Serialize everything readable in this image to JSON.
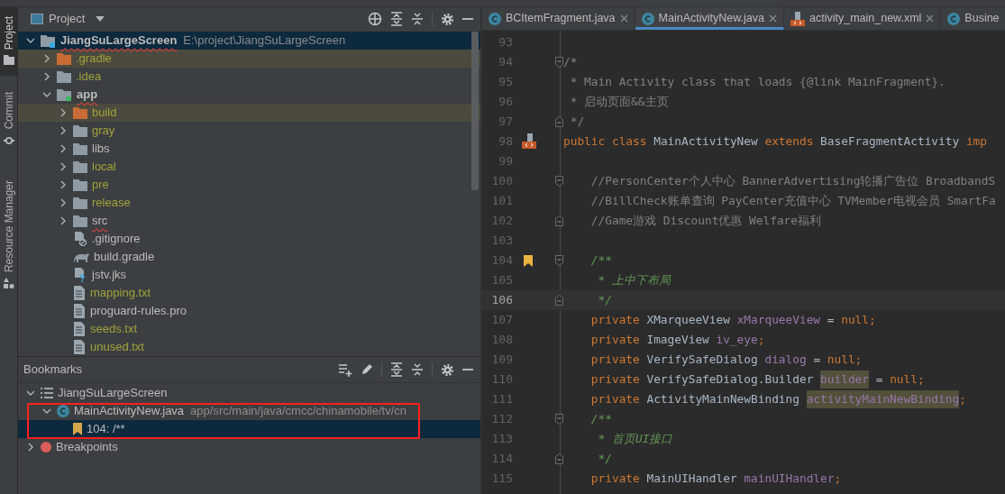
{
  "tool_stripe": [
    {
      "label": "Project",
      "kind": "folder",
      "selected": true
    },
    {
      "label": "Commit",
      "kind": "commit",
      "selected": false
    },
    {
      "label": "Resource Manager",
      "kind": "shapes",
      "selected": false
    }
  ],
  "project_panel": {
    "title": "Project",
    "tree": [
      {
        "label": "JiangSuLargeScreen",
        "path": "E:\\project\\JiangSuLargeScreen",
        "kind": "root",
        "expanded": true,
        "selected": true,
        "ignored": false,
        "misspelled": true,
        "children": [
          {
            "label": ".gradle",
            "kind": "folder",
            "expanded": false,
            "selected": false,
            "excluded": true,
            "ignored": true,
            "misspelled": false
          },
          {
            "label": ".idea",
            "kind": "folder",
            "expanded": false,
            "selected": false,
            "excluded": false,
            "ignored": true,
            "misspelled": false
          },
          {
            "label": "app",
            "kind": "module",
            "expanded": true,
            "selected": false,
            "excluded": false,
            "ignored": false,
            "misspelled": true,
            "children": [
              {
                "label": "build",
                "kind": "folder",
                "expanded": false,
                "selected": false,
                "excluded": true,
                "ignored": true,
                "misspelled": false
              },
              {
                "label": "gray",
                "kind": "folder",
                "expanded": false,
                "selected": false,
                "excluded": false,
                "ignored": true,
                "misspelled": false
              },
              {
                "label": "libs",
                "kind": "folder",
                "expanded": false,
                "selected": false,
                "excluded": false,
                "ignored": false,
                "misspelled": false
              },
              {
                "label": "local",
                "kind": "folder",
                "expanded": false,
                "selected": false,
                "excluded": false,
                "ignored": true,
                "misspelled": false
              },
              {
                "label": "pre",
                "kind": "folder",
                "expanded": false,
                "selected": false,
                "excluded": false,
                "ignored": true,
                "misspelled": false
              },
              {
                "label": "release",
                "kind": "folder",
                "expanded": false,
                "selected": false,
                "excluded": false,
                "ignored": true,
                "misspelled": false
              },
              {
                "label": "src",
                "kind": "folder",
                "expanded": false,
                "selected": false,
                "excluded": false,
                "ignored": false,
                "misspelled": true
              },
              {
                "label": ".gitignore",
                "kind": "gitignore",
                "selected": false,
                "excluded": false,
                "ignored": false,
                "misspelled": false
              },
              {
                "label": "build.gradle",
                "kind": "gradle",
                "selected": false,
                "excluded": false,
                "ignored": false,
                "misspelled": false
              },
              {
                "label": "jstv.jks",
                "kind": "keystore",
                "selected": false,
                "excluded": false,
                "ignored": false,
                "misspelled": false
              },
              {
                "label": "mapping.txt",
                "kind": "text",
                "selected": false,
                "excluded": false,
                "ignored": true,
                "misspelled": false
              },
              {
                "label": "proguard-rules.pro",
                "kind": "text",
                "selected": false,
                "excluded": false,
                "ignored": false,
                "misspelled": false
              },
              {
                "label": "seeds.txt",
                "kind": "text",
                "selected": false,
                "excluded": false,
                "ignored": true,
                "misspelled": false
              },
              {
                "label": "unused.txt",
                "kind": "text",
                "selected": false,
                "excluded": false,
                "ignored": true,
                "misspelled": false
              }
            ]
          }
        ]
      }
    ]
  },
  "bookmarks_panel": {
    "title": "Bookmarks",
    "tree": [
      {
        "label": "JiangSuLargeScreen",
        "kind": "list",
        "expanded": true,
        "selected": false,
        "children": [
          {
            "label": "MainActivityNew.java",
            "path": "app/src/main/java/cmcc/chinamobile/tv/cn",
            "kind": "class",
            "expanded": true,
            "selected": false,
            "children": [
              {
                "label": "104: /**",
                "kind": "bookmark",
                "selected": true
              }
            ]
          }
        ]
      },
      {
        "label": "Breakpoints",
        "kind": "breakpoint",
        "expanded": false,
        "selected": false
      }
    ]
  },
  "editor": {
    "tabs": [
      {
        "label": "BCItemFragment.java",
        "kind": "class",
        "selected": false
      },
      {
        "label": "MainActivityNew.java",
        "kind": "class",
        "selected": true
      },
      {
        "label": "activity_main_new.xml",
        "kind": "layout",
        "selected": false
      },
      {
        "label": "Busine",
        "kind": "class",
        "selected": false
      }
    ],
    "lines": [
      {
        "number": "93",
        "current": false,
        "fold_start": false,
        "fold_end": false,
        "bookmarked": false,
        "implemented": false
      },
      {
        "number": "94",
        "current": false,
        "fold_start": true,
        "fold_end": false,
        "bookmarked": false,
        "implemented": false,
        "tokens": [
          {
            "kind": "comment",
            "text": "/*"
          }
        ]
      },
      {
        "number": "95",
        "current": false,
        "fold_start": false,
        "fold_end": false,
        "bookmarked": false,
        "implemented": false,
        "tokens": [
          {
            "kind": "comment",
            "text": " * Main Activity class that loads {@link MainFragment}."
          }
        ]
      },
      {
        "number": "96",
        "current": false,
        "fold_start": false,
        "fold_end": false,
        "bookmarked": false,
        "implemented": false,
        "tokens": [
          {
            "kind": "comment",
            "text": " * 启动页面&&主页"
          }
        ]
      },
      {
        "number": "97",
        "current": false,
        "fold_start": false,
        "fold_end": true,
        "bookmarked": false,
        "implemented": false,
        "tokens": [
          {
            "kind": "comment",
            "text": " */"
          }
        ]
      },
      {
        "number": "98",
        "current": false,
        "fold_start": false,
        "fold_end": false,
        "bookmarked": false,
        "implemented": true,
        "tokens": [
          {
            "kind": "keyword",
            "text": "public class "
          },
          {
            "kind": "plain",
            "text": "MainActivityNew "
          },
          {
            "kind": "keyword",
            "text": "extends "
          },
          {
            "kind": "plain",
            "text": "BaseFragmentActivity "
          },
          {
            "kind": "keyword",
            "text": "imp"
          }
        ]
      },
      {
        "number": "99",
        "current": false,
        "fold_start": false,
        "fold_end": false,
        "bookmarked": false,
        "implemented": false
      },
      {
        "number": "100",
        "current": false,
        "fold_start": true,
        "fold_end": false,
        "bookmarked": false,
        "implemented": false,
        "tokens": [
          {
            "kind": "comment",
            "text": "    //PersonCenter个人中心 BannerAdvertising轮播广告位 BroadbandS"
          }
        ]
      },
      {
        "number": "101",
        "current": false,
        "fold_start": false,
        "fold_end": false,
        "bookmarked": false,
        "implemented": false,
        "tokens": [
          {
            "kind": "comment",
            "text": "    //BillCheck账单查询 PayCenter充值中心 TVMember电视会员 SmartFa"
          }
        ]
      },
      {
        "number": "102",
        "current": false,
        "fold_start": false,
        "fold_end": true,
        "bookmarked": false,
        "implemented": false,
        "tokens": [
          {
            "kind": "comment",
            "text": "    //Game游戏 Discount优惠 Welfare福利"
          }
        ]
      },
      {
        "number": "103",
        "current": false,
        "fold_start": false,
        "fold_end": false,
        "bookmarked": false,
        "implemented": false
      },
      {
        "number": "104",
        "current": false,
        "fold_start": true,
        "fold_end": false,
        "bookmarked": true,
        "implemented": false,
        "tokens": [
          {
            "kind": "doc",
            "text": "    /**"
          }
        ]
      },
      {
        "number": "105",
        "current": false,
        "fold_start": false,
        "fold_end": false,
        "bookmarked": false,
        "implemented": false,
        "tokens": [
          {
            "kind": "doc",
            "text": "     * 上中下布局"
          }
        ]
      },
      {
        "number": "106",
        "current": true,
        "fold_start": false,
        "fold_end": true,
        "bookmarked": false,
        "implemented": false,
        "tokens": [
          {
            "kind": "doc",
            "text": "     */"
          }
        ]
      },
      {
        "number": "107",
        "current": false,
        "fold_start": false,
        "fold_end": false,
        "bookmarked": false,
        "implemented": false,
        "tokens": [
          {
            "kind": "keyword",
            "text": "    private "
          },
          {
            "kind": "plain",
            "text": "XMarqueeView "
          },
          {
            "kind": "field",
            "text": "xMarqueeView"
          },
          {
            "kind": "plain",
            "text": " = "
          },
          {
            "kind": "keyword",
            "text": "null;"
          }
        ]
      },
      {
        "number": "108",
        "current": false,
        "fold_start": false,
        "fold_end": false,
        "bookmarked": false,
        "implemented": false,
        "tokens": [
          {
            "kind": "keyword",
            "text": "    private "
          },
          {
            "kind": "plain",
            "text": "ImageView "
          },
          {
            "kind": "field",
            "text": "iv_eye"
          },
          {
            "kind": "keyword",
            "text": ";"
          }
        ]
      },
      {
        "number": "109",
        "current": false,
        "fold_start": false,
        "fold_end": false,
        "bookmarked": false,
        "implemented": false,
        "tokens": [
          {
            "kind": "keyword",
            "text": "    private "
          },
          {
            "kind": "plain",
            "text": "VerifySafeDialog "
          },
          {
            "kind": "field",
            "text": "dialog"
          },
          {
            "kind": "plain",
            "text": " = "
          },
          {
            "kind": "keyword",
            "text": "null;"
          }
        ]
      },
      {
        "number": "110",
        "current": false,
        "fold_start": false,
        "fold_end": false,
        "bookmarked": false,
        "implemented": false,
        "tokens": [
          {
            "kind": "keyword",
            "text": "    private "
          },
          {
            "kind": "plain",
            "text": "VerifySafeDialog.Builder "
          },
          {
            "kind": "field_marked",
            "text": "builder"
          },
          {
            "kind": "plain",
            "text": " = "
          },
          {
            "kind": "keyword",
            "text": "null;"
          }
        ]
      },
      {
        "number": "111",
        "current": false,
        "fold_start": false,
        "fold_end": false,
        "bookmarked": false,
        "implemented": false,
        "tokens": [
          {
            "kind": "keyword",
            "text": "    private "
          },
          {
            "kind": "plain",
            "text": "ActivityMainNewBinding "
          },
          {
            "kind": "field_marked",
            "text": "activityMainNewBinding"
          },
          {
            "kind": "keyword",
            "text": ";"
          }
        ]
      },
      {
        "number": "112",
        "current": false,
        "fold_start": true,
        "fold_end": false,
        "bookmarked": false,
        "implemented": false,
        "tokens": [
          {
            "kind": "doc",
            "text": "    /**"
          }
        ]
      },
      {
        "number": "113",
        "current": false,
        "fold_start": false,
        "fold_end": false,
        "bookmarked": false,
        "implemented": false,
        "tokens": [
          {
            "kind": "doc",
            "text": "     * 首页UI接口"
          }
        ]
      },
      {
        "number": "114",
        "current": false,
        "fold_start": false,
        "fold_end": true,
        "bookmarked": false,
        "implemented": false,
        "tokens": [
          {
            "kind": "doc",
            "text": "     */"
          }
        ]
      },
      {
        "number": "115",
        "current": false,
        "fold_start": false,
        "fold_end": false,
        "bookmarked": false,
        "implemented": false,
        "tokens": [
          {
            "kind": "keyword",
            "text": "    private "
          },
          {
            "kind": "plain",
            "text": "MainUIHandler "
          },
          {
            "kind": "field",
            "text": "mainUIHandler"
          },
          {
            "kind": "keyword",
            "text": ";"
          }
        ]
      }
    ]
  }
}
